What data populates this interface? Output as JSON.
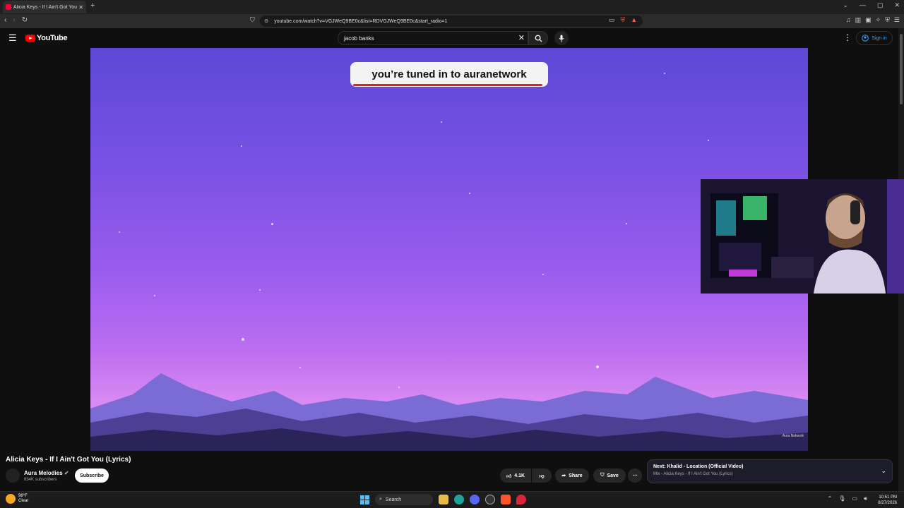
{
  "browser": {
    "tab_title": "Alicia Keys - If I Ain't Got You",
    "url": "youtube.com/watch?v=VGJWeQ9BE0c&list=RDVGJWeQ9BE0c&start_radio=1"
  },
  "youtube": {
    "logo_text": "YouTube",
    "search_value": "jacob banks",
    "signin_label": "Sign in"
  },
  "video": {
    "overlay_text": "you’re tuned in to auranetwork",
    "watermark": "Aura Network",
    "title": "Alicia Keys - If I Ain't Got You (Lyrics)",
    "channel": "Aura Melodies",
    "subscribers": "834K subscribers",
    "subscribe_label": "Subscribe",
    "likes": "4.1K",
    "share_label": "Share",
    "save_label": "Save"
  },
  "upnext": {
    "title": "Next: Khalid - Location (Official Video)",
    "subtitle": "Mix - Alicia Keys - If I Ain't Got You (Lyrics)"
  },
  "taskbar": {
    "temperature": "98°F",
    "condition": "Clear",
    "search_label": "Search",
    "time": "10:51 PM",
    "date": "8/27/2026"
  },
  "colors": {
    "accent_red": "#ff0000",
    "link_blue": "#3ea6ff"
  },
  "icons": [
    "menu-icon",
    "search-icon",
    "mic-icon",
    "close-icon",
    "like-icon",
    "dislike-icon",
    "share-icon",
    "save-icon",
    "more-icon",
    "chevron-down-icon"
  ]
}
